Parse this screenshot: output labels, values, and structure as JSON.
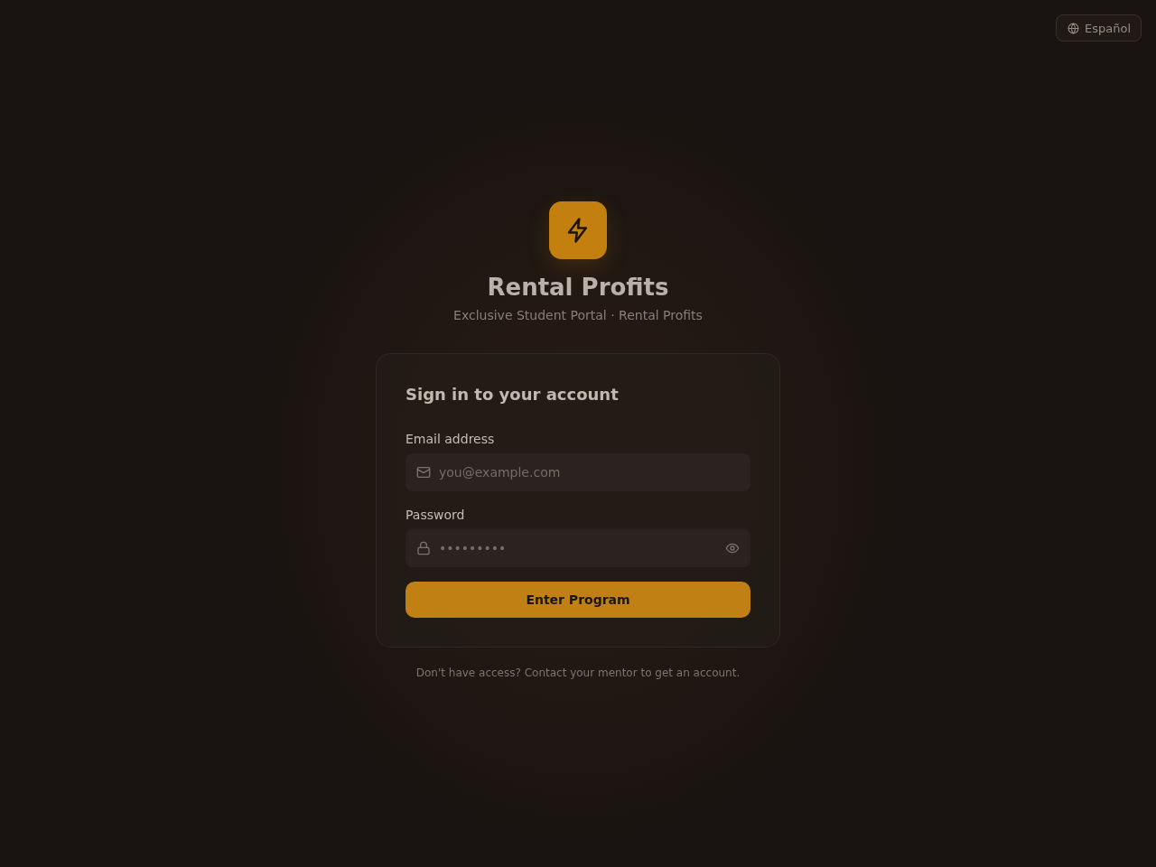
{
  "language_button": {
    "label": "Español"
  },
  "brand": {
    "title": "Rental Profits",
    "subtitle": "Exclusive Student Portal · Rental Profits"
  },
  "login_card": {
    "heading": "Sign in to your account",
    "fields": [
      {
        "kind": "email",
        "label": "Email address",
        "placeholder": "you@example.com"
      },
      {
        "kind": "password",
        "label": "Password",
        "placeholder": "•••••••••"
      }
    ],
    "submit_button": "Enter Program"
  },
  "footer": "Don't have access? Contact your mentor to get an account."
}
